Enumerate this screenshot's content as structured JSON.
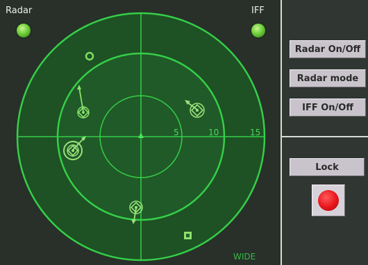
{
  "indicators": {
    "radar_label": "Radar",
    "iff_label": "IFF"
  },
  "scope": {
    "range_labels": [
      "5",
      "10",
      "15"
    ],
    "mode_label": "WIDE",
    "colors": {
      "background": "#283029",
      "scope_fill": "#1f5526",
      "ring": "#39d34a",
      "contact": "#8be26c"
    }
  },
  "controls": {
    "radar_onoff": "Radar On/Off",
    "radar_mode": "Radar mode",
    "iff_onoff": "IFF On/Off",
    "lock": "Lock"
  },
  "icons": {
    "radar_led": "green-led-icon",
    "iff_led": "green-led-icon",
    "fire_button": "red-circle-icon"
  }
}
